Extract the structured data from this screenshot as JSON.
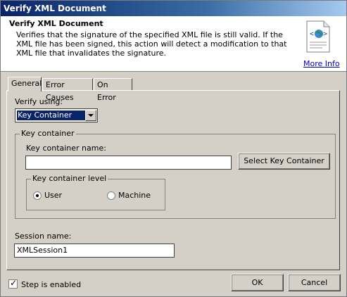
{
  "window": {
    "title": "Verify XML Document"
  },
  "header": {
    "title": "Verify XML Document",
    "description": "Verifies that the signature of the specified XML file is still valid.  If the XML file has been signed, this action will detect a modification to that XML file that invalidates the signature.",
    "more_info": "More Info",
    "icon": "xml-document-icon"
  },
  "tabs": [
    {
      "label": "General"
    },
    {
      "label": "Error Causes"
    },
    {
      "label": "On Error"
    }
  ],
  "general": {
    "verify_label": "Verify using:",
    "verify_value": "Key Container",
    "key_container_group": "Key container",
    "key_container_name_label": "Key container name:",
    "key_container_name_value": "",
    "select_key_button": "Select Key Container",
    "level_group": "Key container level",
    "user_label": "User",
    "machine_label": "Machine",
    "selected_level": "User",
    "session_label": "Session name:",
    "session_value": "XMLSession1"
  },
  "footer": {
    "step_enabled_label": "Step is enabled",
    "step_enabled": true,
    "ok": "OK",
    "cancel": "Cancel"
  }
}
